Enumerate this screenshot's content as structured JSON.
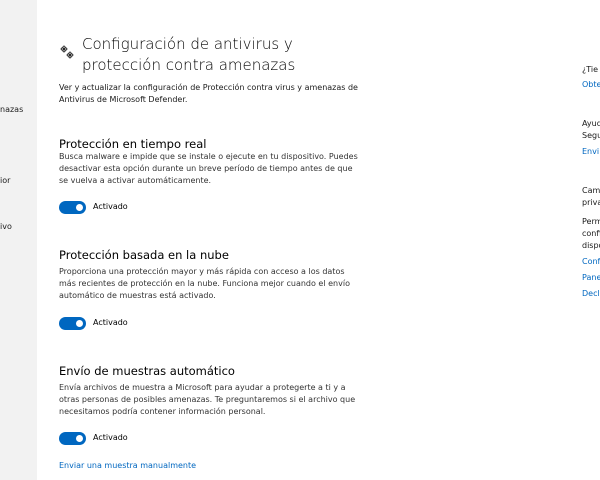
{
  "nav": {
    "items": [
      "nazas",
      "ior",
      "ivo"
    ]
  },
  "header": {
    "title_line1": "Configuración de antivirus y",
    "title_line2": "protección contra amenazas",
    "icon": "gear-icon"
  },
  "intro": "Ver y actualizar la configuración de Protección contra virus y amenazas de Antivirus de Microsoft Defender.",
  "sections": [
    {
      "title": "Protección en tiempo real",
      "description": "Busca malware e impide que se instale o ejecute en tu dispositivo. Puedes desactivar esta opción durante un breve período de tiempo antes de que se vuelva a activar automáticamente.",
      "toggle_state": "Activado"
    },
    {
      "title": "Protección basada en la nube",
      "description": "Proporciona una protección mayor y más rápida con acceso a los datos más recientes de protección en la nube. Funciona mejor cuando el envío automático de muestras está activado.",
      "toggle_state": "Activado"
    },
    {
      "title": "Envío de muestras automático",
      "description": "Envía archivos de muestra a Microsoft para ayudar a protegerte a ti y a otras personas de posibles amenazas. Te preguntaremos si el archivo que necesitamos podría contener información personal.",
      "toggle_state": "Activado"
    }
  ],
  "manual_link": "Enviar una muestra manualmente",
  "right_rail": {
    "q1": "¿Tie",
    "q1_link": "Obte",
    "help_line1": "Ayud",
    "help_line2": "Segu",
    "help_link": "Envi",
    "privacy_line1": "Cam",
    "privacy_line2": "priva",
    "privacy_text1": "Perm",
    "privacy_text2": "confi",
    "privacy_text3": "dispo",
    "privacy_link1": "Conf",
    "privacy_link2": "Pane",
    "privacy_link3": "Decla"
  },
  "colors": {
    "accent": "#0067c0",
    "nav_bg": "#f2f2f2"
  }
}
